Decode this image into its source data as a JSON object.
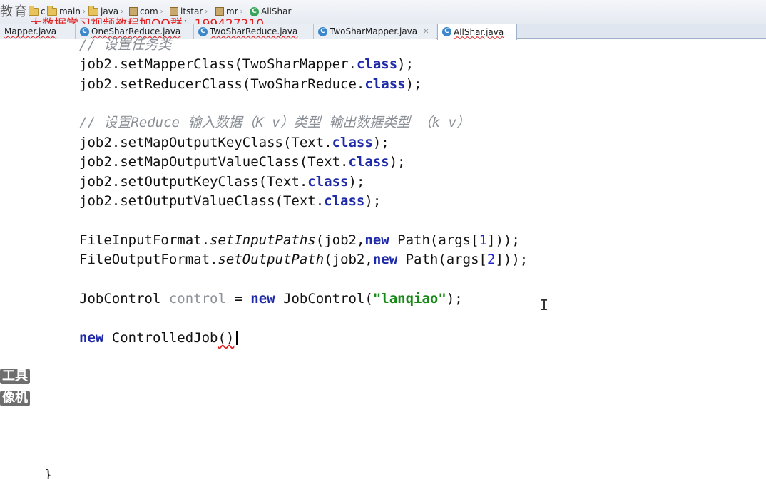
{
  "overlay": {
    "brand": "教育",
    "watermark": "大数据学习视频教程加QQ群：199427210",
    "left_labels": [
      "工具",
      "像机"
    ]
  },
  "breadcrumb": [
    {
      "label": "c",
      "icon": "folder-icon"
    },
    {
      "label": "main",
      "icon": "folder-icon"
    },
    {
      "label": "java",
      "icon": "folder-icon"
    },
    {
      "label": "com",
      "icon": "package-icon"
    },
    {
      "label": "itstar",
      "icon": "package-icon"
    },
    {
      "label": "mr",
      "icon": "package-icon"
    },
    {
      "label": "AllShar",
      "icon": "class-icon"
    }
  ],
  "tabs": [
    {
      "label": "Mapper.java",
      "active": false
    },
    {
      "label": "OneSharReduce.java",
      "active": false
    },
    {
      "label": "TwoSharReduce.java",
      "active": false
    },
    {
      "label": "TwoSharMapper.java",
      "active": false
    },
    {
      "label": "AllShar.java",
      "active": true
    }
  ],
  "code": {
    "l1_comment": "// 设置任务类",
    "l2a": "job2.setMapperClass(TwoSharMapper.",
    "l2kw": "class",
    "l2b": ");",
    "l3a": "job2.setReducerClass(TwoSharReduce.",
    "l3kw": "class",
    "l3b": ");",
    "l4_comment": "// 设置Reduce 输入数据（K v）类型 输出数据类型 （k v）",
    "l5a": "job2.setMapOutputKeyClass(Text.",
    "l5kw": "class",
    "l5b": ");",
    "l6a": "job2.setMapOutputValueClass(Text.",
    "l6kw": "class",
    "l6b": ");",
    "l7a": "job2.setOutputKeyClass(Text.",
    "l7kw": "class",
    "l7b": ");",
    "l8a": "job2.setOutputValueClass(Text.",
    "l8kw": "class",
    "l8b": ");",
    "l9a": "FileInputFormat.",
    "l9m": "setInputPaths",
    "l9b": "(job2,",
    "l9kw": "new",
    "l9c": " Path(args[",
    "l9n": "1",
    "l9d": "]));",
    "l10a": "FileOutputFormat.",
    "l10m": "setOutputPath",
    "l10b": "(job2,",
    "l10kw": "new",
    "l10c": " Path(args[",
    "l10n": "2",
    "l10d": "]));",
    "l11a": "JobControl ",
    "l11var": "control",
    "l11b": " = ",
    "l11kw": "new",
    "l11c": " JobControl(",
    "l11str": "\"lanqiao\"",
    "l11d": ");",
    "l12kw": "new",
    "l12a": " ControlledJob",
    "l12b": "()",
    "l13": "}"
  },
  "cursor_icon": "text-cursor-icon"
}
